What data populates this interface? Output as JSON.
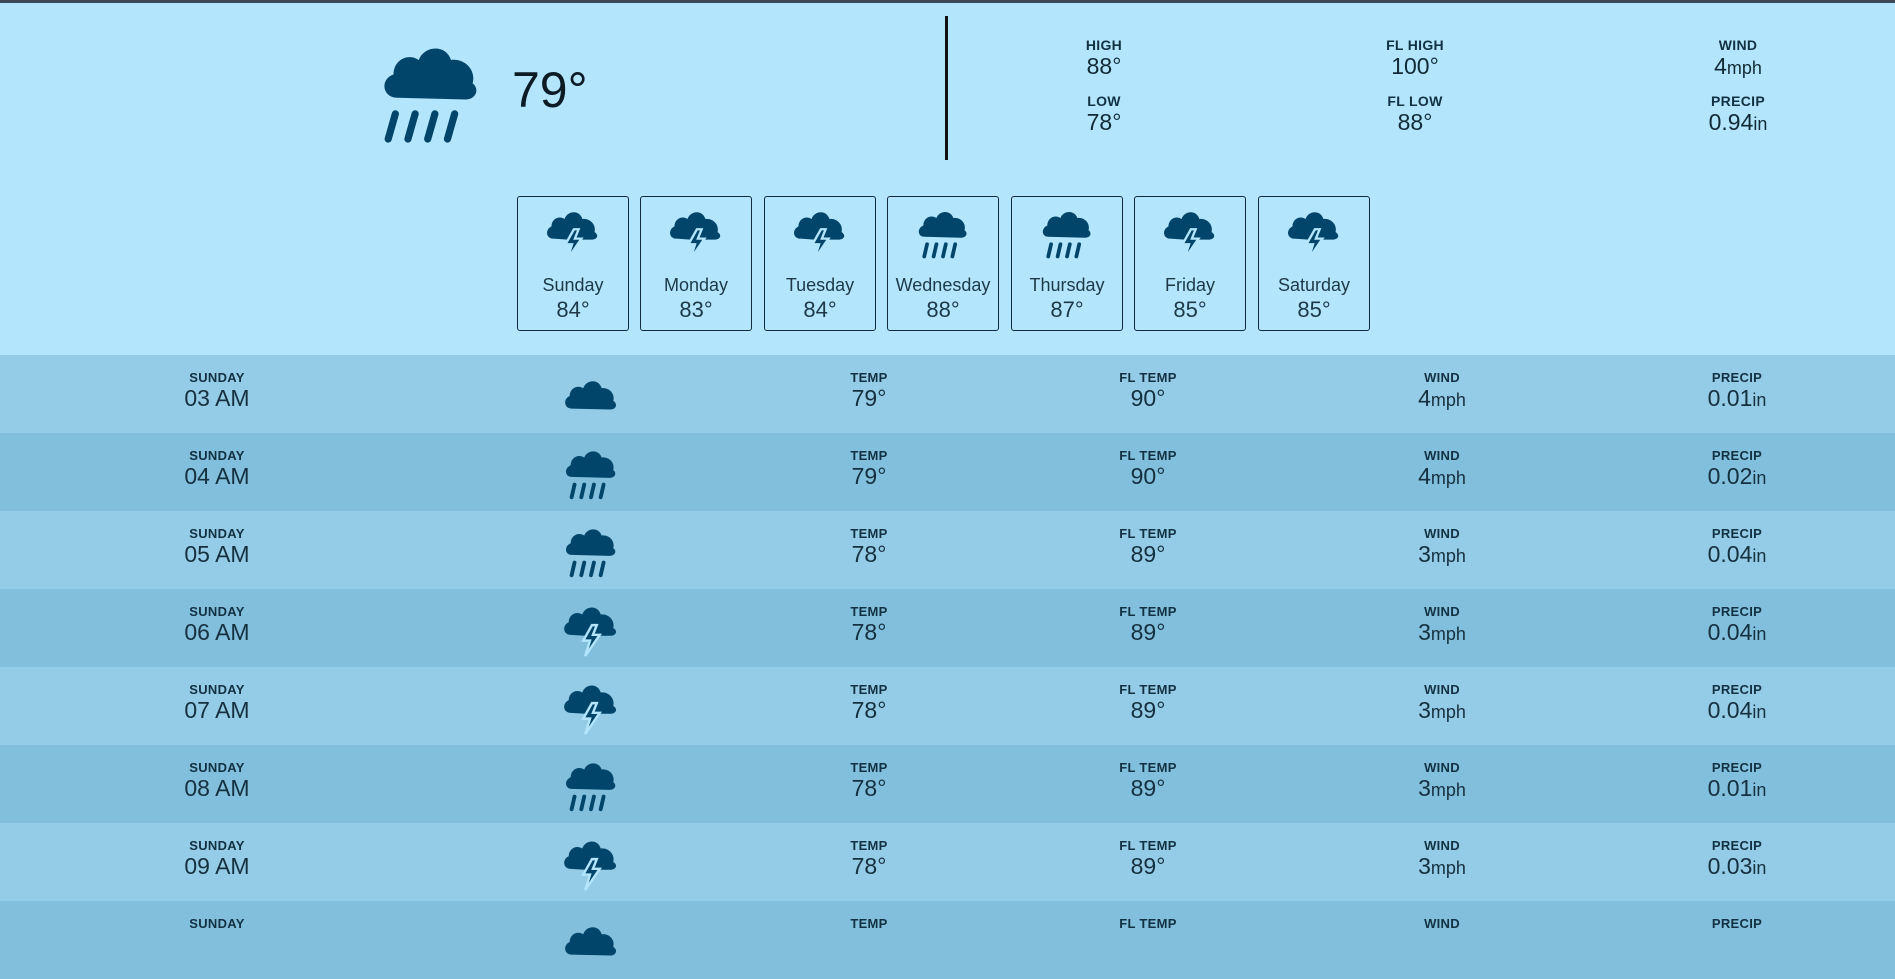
{
  "current": {
    "icon": "cloud-rain-icon",
    "temp": "79°",
    "high_label": "HIGH",
    "high": "88°",
    "low_label": "LOW",
    "low": "78°",
    "fl_high_label": "FL HIGH",
    "fl_high": "100°",
    "fl_low_label": "FL LOW",
    "fl_low": "88°",
    "wind_label": "WIND",
    "wind": "4",
    "wind_unit": "mph",
    "precip_label": "PRECIP",
    "precip": "0.94",
    "precip_unit": "in"
  },
  "days": [
    {
      "name": "Sunday",
      "temp": "84°",
      "icon": "thunderstorm-icon"
    },
    {
      "name": "Monday",
      "temp": "83°",
      "icon": "thunderstorm-icon"
    },
    {
      "name": "Tuesday",
      "temp": "84°",
      "icon": "thunderstorm-icon"
    },
    {
      "name": "Wednesday",
      "temp": "88°",
      "icon": "cloud-rain-icon"
    },
    {
      "name": "Thursday",
      "temp": "87°",
      "icon": "cloud-rain-icon"
    },
    {
      "name": "Friday",
      "temp": "85°",
      "icon": "thunderstorm-icon"
    },
    {
      "name": "Saturday",
      "temp": "85°",
      "icon": "thunderstorm-icon"
    }
  ],
  "labels": {
    "temp": "TEMP",
    "fl_temp": "FL TEMP",
    "wind": "WIND",
    "precip": "PRECIP",
    "wind_unit": "mph",
    "precip_unit": "in"
  },
  "hours": [
    {
      "day": "SUNDAY",
      "time": "03 AM",
      "icon": "cloud-icon",
      "temp": "79°",
      "fl_temp": "90°",
      "wind": "4",
      "precip": "0.01"
    },
    {
      "day": "SUNDAY",
      "time": "04 AM",
      "icon": "cloud-rain-icon",
      "temp": "79°",
      "fl_temp": "90°",
      "wind": "4",
      "precip": "0.02"
    },
    {
      "day": "SUNDAY",
      "time": "05 AM",
      "icon": "cloud-rain-icon",
      "temp": "78°",
      "fl_temp": "89°",
      "wind": "3",
      "precip": "0.04"
    },
    {
      "day": "SUNDAY",
      "time": "06 AM",
      "icon": "thunderstorm-icon",
      "temp": "78°",
      "fl_temp": "89°",
      "wind": "3",
      "precip": "0.04"
    },
    {
      "day": "SUNDAY",
      "time": "07 AM",
      "icon": "thunderstorm-icon",
      "temp": "78°",
      "fl_temp": "89°",
      "wind": "3",
      "precip": "0.04"
    },
    {
      "day": "SUNDAY",
      "time": "08 AM",
      "icon": "cloud-rain-icon",
      "temp": "78°",
      "fl_temp": "89°",
      "wind": "3",
      "precip": "0.01"
    },
    {
      "day": "SUNDAY",
      "time": "09 AM",
      "icon": "thunderstorm-icon",
      "temp": "78°",
      "fl_temp": "89°",
      "wind": "3",
      "precip": "0.03"
    },
    {
      "day": "SUNDAY",
      "time": "",
      "icon": "cloud-icon",
      "temp": "",
      "fl_temp": "",
      "wind": "",
      "precip": ""
    }
  ]
}
